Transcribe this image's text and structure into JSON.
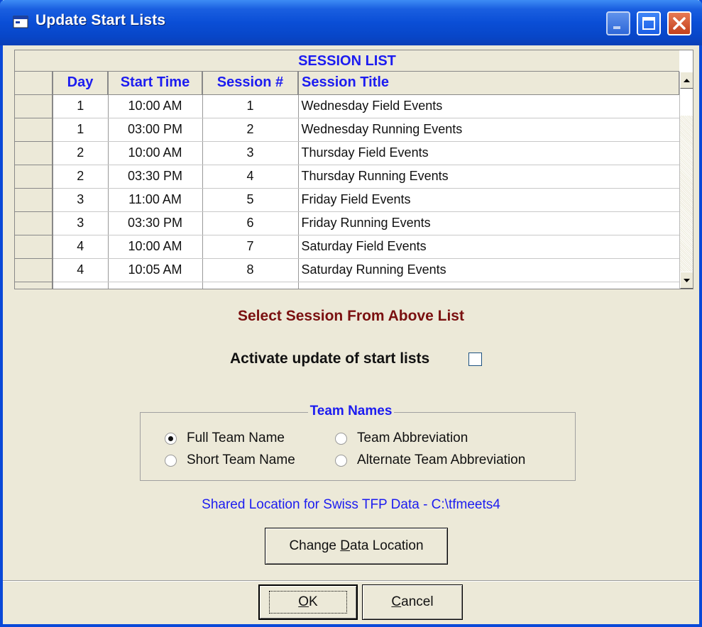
{
  "window": {
    "title": "Update Start Lists",
    "title_icon": "app-window-icon",
    "controls": [
      "minimize-icon",
      "maximize-icon",
      "close-icon"
    ]
  },
  "session_list": {
    "caption": "SESSION LIST",
    "columns": [
      "Day",
      "Start Time",
      "Session #",
      "Session Title"
    ],
    "rows": [
      {
        "day": "1",
        "start": "10:00 AM",
        "session": "1",
        "title": "Wednesday Field Events"
      },
      {
        "day": "1",
        "start": "03:00 PM",
        "session": "2",
        "title": "Wednesday Running Events"
      },
      {
        "day": "2",
        "start": "10:00 AM",
        "session": "3",
        "title": "Thursday Field Events"
      },
      {
        "day": "2",
        "start": "03:30 PM",
        "session": "4",
        "title": "Thursday Running Events"
      },
      {
        "day": "3",
        "start": "11:00 AM",
        "session": "5",
        "title": "Friday Field Events"
      },
      {
        "day": "3",
        "start": "03:30 PM",
        "session": "6",
        "title": "Friday Running Events"
      },
      {
        "day": "4",
        "start": "10:00 AM",
        "session": "7",
        "title": "Saturday Field Events"
      },
      {
        "day": "4",
        "start": "10:05 AM",
        "session": "8",
        "title": "Saturday Running Events"
      }
    ]
  },
  "select_message": "Select Session From Above List",
  "activate": {
    "label": "Activate update of start lists",
    "checked": false
  },
  "team_names": {
    "legend": "Team Names",
    "options": [
      {
        "label": "Full Team Name",
        "selected": true
      },
      {
        "label": "Team Abbreviation",
        "selected": false
      },
      {
        "label": "Short Team Name",
        "selected": false
      },
      {
        "label": "Alternate Team Abbreviation",
        "selected": false
      }
    ]
  },
  "shared_location": "Shared Location for Swiss TFP Data  -  C:\\tfmeets4",
  "buttons": {
    "change_data_location": {
      "pre": "Change ",
      "accel": "D",
      "post": "ata Location"
    },
    "ok": {
      "pre": "",
      "accel": "O",
      "post": "K"
    },
    "cancel": {
      "pre": "",
      "accel": "C",
      "post": "ancel"
    }
  },
  "colors": {
    "title_bar": "#0a4ed6",
    "header_text": "#1c1cf0",
    "select_msg": "#7a1010",
    "dialog_bg": "#ece9d8"
  }
}
